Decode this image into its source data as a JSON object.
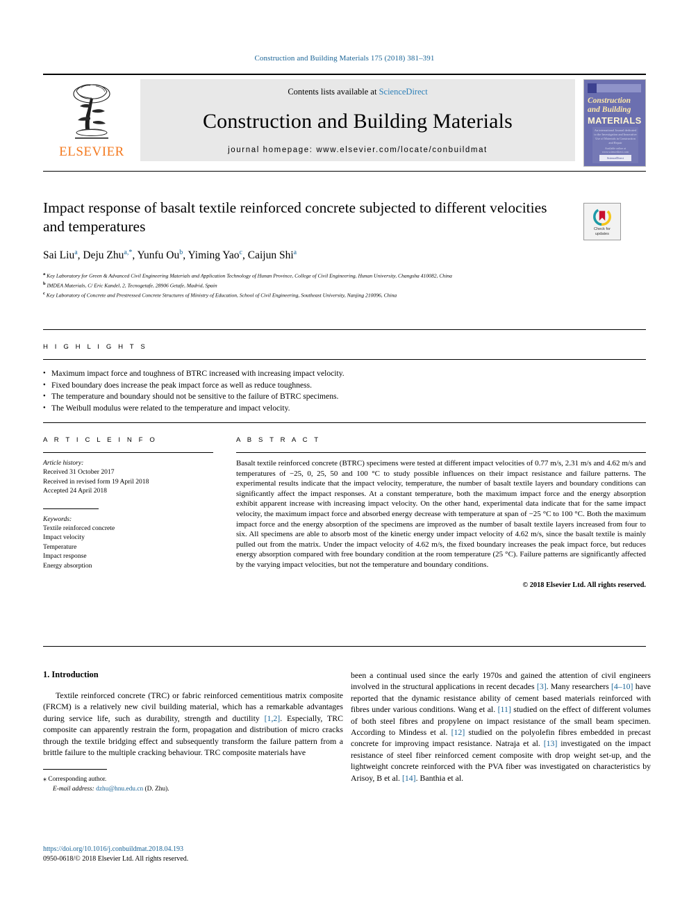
{
  "running_head": "Construction and Building Materials 175 (2018) 381–391",
  "masthead": {
    "contents_prefix": "Contents lists available at ",
    "sciencedirect": "ScienceDirect",
    "journal_title": "Construction and Building Materials",
    "homepage": "journal homepage: www.elsevier.com/locate/conbuildmat",
    "publisher_logo_text": "ELSEVIER",
    "publisher_accent_color": "#f47a20",
    "sciencedirect_color": "#2c7fb8",
    "cover": {
      "line1": "Construction",
      "line2": "and Building",
      "line3": "MATERIALS",
      "blurb": "An international Journal dedicated to the Investigation and Innovative Use of Materials in Construction and Repair",
      "footer_badge": "ScienceDirect",
      "footer_label": "Available online at www.sciencedirect.com",
      "background_color": "#6b6fb0",
      "title_color": "#ffe9a8"
    }
  },
  "article": {
    "title": "Impact response of basalt textile reinforced concrete subjected to different velocities and temperatures",
    "authors": [
      {
        "name": "Sai Liu",
        "sup": "a"
      },
      {
        "name": "Deju Zhu",
        "sup": "a,*"
      },
      {
        "name": "Yunfu Ou",
        "sup": "b"
      },
      {
        "name": "Yiming Yao",
        "sup": "c"
      },
      {
        "name": "Caijun Shi",
        "sup": "a"
      }
    ],
    "authors_line": "Sai Liu a, Deju Zhu a,*, Yunfu Ou b, Yiming Yao c, Caijun Shi a",
    "affiliations": [
      {
        "marker": "a",
        "text": "Key Laboratory for Green & Advanced Civil Engineering Materials and Application Technology of Hunan Province, College of Civil Engineering, Hunan University, Changsha 410082, China"
      },
      {
        "marker": "b",
        "text": "IMDEA Materials, C/ Eric Kandel, 2, Tecnogetafe, 28906 Getafe, Madrid, Spain"
      },
      {
        "marker": "c",
        "text": "Key Laboratory of Concrete and Prestressed Concrete Structures of Ministry of Education, School of Civil Engineering, Southeast University, Nanjing 210096, China"
      }
    ],
    "crossmark": {
      "line1": "Check for",
      "line2": "updates"
    }
  },
  "highlights": {
    "heading": "H I G H L I G H T S",
    "items": [
      "Maximum impact force and toughness of BTRC increased with increasing impact velocity.",
      "Fixed boundary does increase the peak impact force as well as reduce toughness.",
      "The temperature and boundary should not be sensitive to the failure of BTRC specimens.",
      "The Weibull modulus were related to the temperature and impact velocity."
    ]
  },
  "article_info": {
    "heading": "A R T I C L E   I N F O",
    "history_label": "Article history:",
    "history": [
      "Received 31 October 2017",
      "Received in revised form 19 April 2018",
      "Accepted 24 April 2018"
    ],
    "keywords_label": "Keywords:",
    "keywords": [
      "Textile reinforced concrete",
      "Impact velocity",
      "Temperature",
      "Impact response",
      "Energy absorption"
    ]
  },
  "abstract": {
    "heading": "A B S T R A C T",
    "text": "Basalt textile reinforced concrete (BTRC) specimens were tested at different impact velocities of 0.77 m/s, 2.31 m/s and 4.62 m/s and temperatures of −25, 0, 25, 50 and 100 °C to study possible influences on their impact resistance and failure patterns. The experimental results indicate that the impact velocity, temperature, the number of basalt textile layers and boundary conditions can significantly affect the impact responses. At a constant temperature, both the maximum impact force and the energy absorption exhibit apparent increase with increasing impact velocity. On the other hand, experimental data indicate that for the same impact velocity, the maximum impact force and absorbed energy decrease with temperature at span of −25 °C to 100 °C. Both the maximum impact force and the energy absorption of the specimens are improved as the number of basalt textile layers increased from four to six. All specimens are able to absorb most of the kinetic energy under impact velocity of 4.62 m/s, since the basalt textile is mainly pulled out from the matrix. Under the impact velocity of 4.62 m/s, the fixed boundary increases the peak impact force, but reduces energy absorption compared with free boundary condition at the room temperature (25 °C). Failure patterns are significantly affected by the varying impact velocities, but not the temperature and boundary conditions.",
    "copyright": "© 2018 Elsevier Ltd. All rights reserved."
  },
  "body": {
    "section_number_title": "1. Introduction",
    "left_paragraph_part1": "Textile reinforced concrete (TRC) or fabric reinforced cementitious matrix composite (FRCM) is a relatively new civil building material, which has a remarkable advantages during service life, such as durability, strength and ductility ",
    "left_ref_1": "[1,2]",
    "left_paragraph_part2": ". Especially, TRC composite can apparently restrain the form, propagation and distribution of micro cracks through the textile bridging effect and subsequently transform the failure pattern from a brittle failure to the multiple cracking behaviour. TRC composite materials have",
    "right_part1": "been a continual used since the early 1970s and gained the attention of civil engineers involved in the structural applications in recent decades ",
    "right_ref_3": "[3]",
    "right_part2": ". Many researchers ",
    "right_ref_410": "[4–10]",
    "right_part3": " have reported that the dynamic resistance ability of cement based materials reinforced with fibres under various conditions. Wang et al. ",
    "right_ref_11": "[11]",
    "right_part4": " studied on the effect of different volumes of both steel fibres and propylene on impact resistance of the small beam specimen. According to Mindess et al. ",
    "right_ref_12": "[12]",
    "right_part5": " studied on the polyolefin fibres embedded in precast concrete for improving impact resistance. Natraja et al. ",
    "right_ref_13": "[13]",
    "right_part6": " investigated on the impact resistance of steel fiber reinforced cement composite with drop weight set-up, and the lightweight concrete reinforced with the PVA fiber was investigated on characteristics by Arisoy, B et al. ",
    "right_ref_14": "[14]",
    "right_part7": ". Banthia et al."
  },
  "footer": {
    "corresponding_marker": "⁎",
    "corresponding_label": "Corresponding author.",
    "email_label": "E-mail address:",
    "email": "dzhu@hnu.edu.cn",
    "email_suffix": "(D. Zhu).",
    "doi": "https://doi.org/10.1016/j.conbuildmat.2018.04.193",
    "issn_line": "0950-0618/© 2018 Elsevier Ltd. All rights reserved.",
    "link_color": "#1a6496"
  }
}
